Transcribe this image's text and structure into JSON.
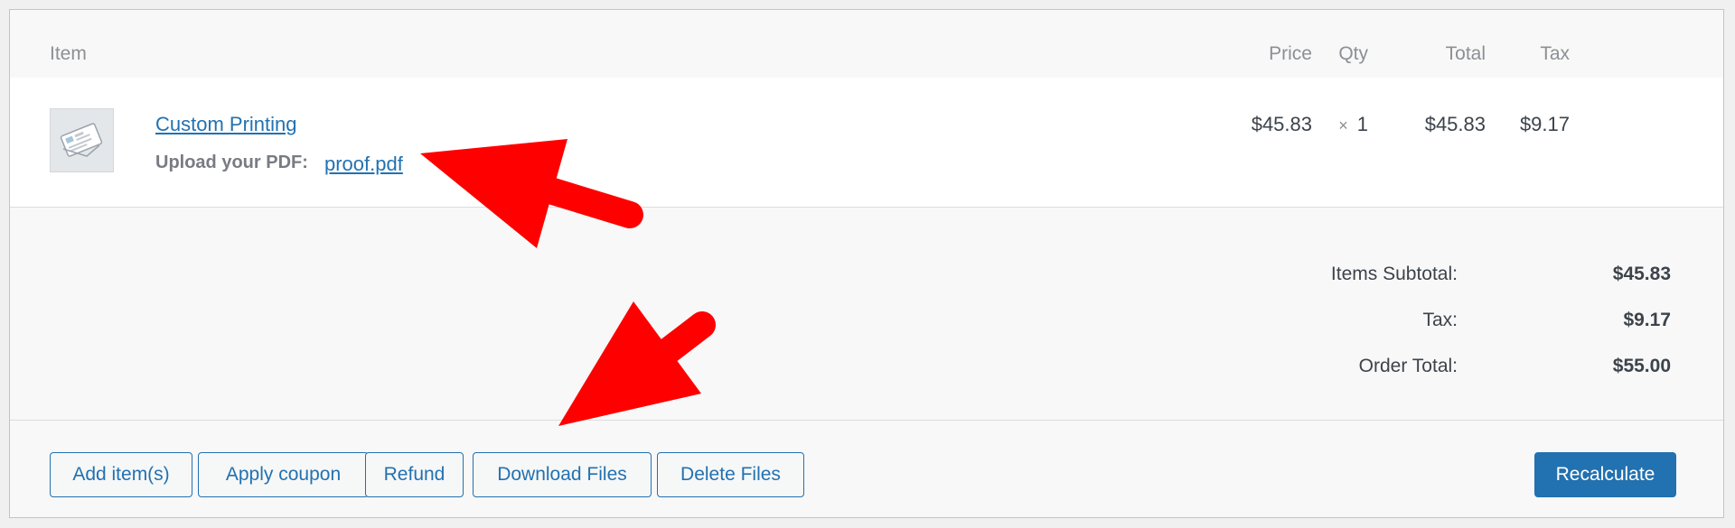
{
  "table": {
    "headers": {
      "item": "Item",
      "price": "Price",
      "qty": "Qty",
      "total": "Total",
      "tax": "Tax"
    },
    "rows": [
      {
        "name": "Custom Printing",
        "meta_label": "Upload your PDF:",
        "meta_file": "proof.pdf",
        "price": "$45.83",
        "qty_symbol": "×",
        "qty": "1",
        "total": "$45.83",
        "tax": "$9.17"
      }
    ]
  },
  "totals": {
    "subtotal_label": "Items Subtotal:",
    "subtotal_value": "$45.83",
    "tax_label": "Tax:",
    "tax_value": "$9.17",
    "order_total_label": "Order Total:",
    "order_total_value": "$55.00"
  },
  "actions": {
    "add_items": "Add item(s)",
    "apply_coupon": "Apply coupon",
    "refund": "Refund",
    "download_files": "Download Files",
    "delete_files": "Delete Files",
    "recalculate": "Recalculate"
  },
  "colors": {
    "link": "#2271b1",
    "primary": "#2271b1",
    "annotation_arrow": "#ff0000"
  },
  "icons": {
    "thumbnail": "product-thumbnail-icon",
    "arrow_1": "annotation-arrow-icon",
    "arrow_2": "annotation-arrow-icon"
  }
}
